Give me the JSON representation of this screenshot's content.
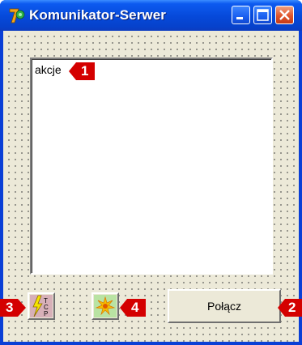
{
  "window": {
    "title": "Komunikator-Serwer",
    "controls": [
      "minimize-icon",
      "maximize-icon",
      "close-icon"
    ]
  },
  "memo": {
    "lines": [
      "akcje"
    ]
  },
  "buttons": {
    "connect_label": "Połącz",
    "button3_icon": "lightning-tcp-icon",
    "button4_icon": "burst-icon"
  },
  "markers": [
    "1",
    "2",
    "3",
    "4"
  ],
  "colors": {
    "titlebar": "#0649d9",
    "client_bg": "#ece9d8",
    "marker_red": "#d40000"
  }
}
